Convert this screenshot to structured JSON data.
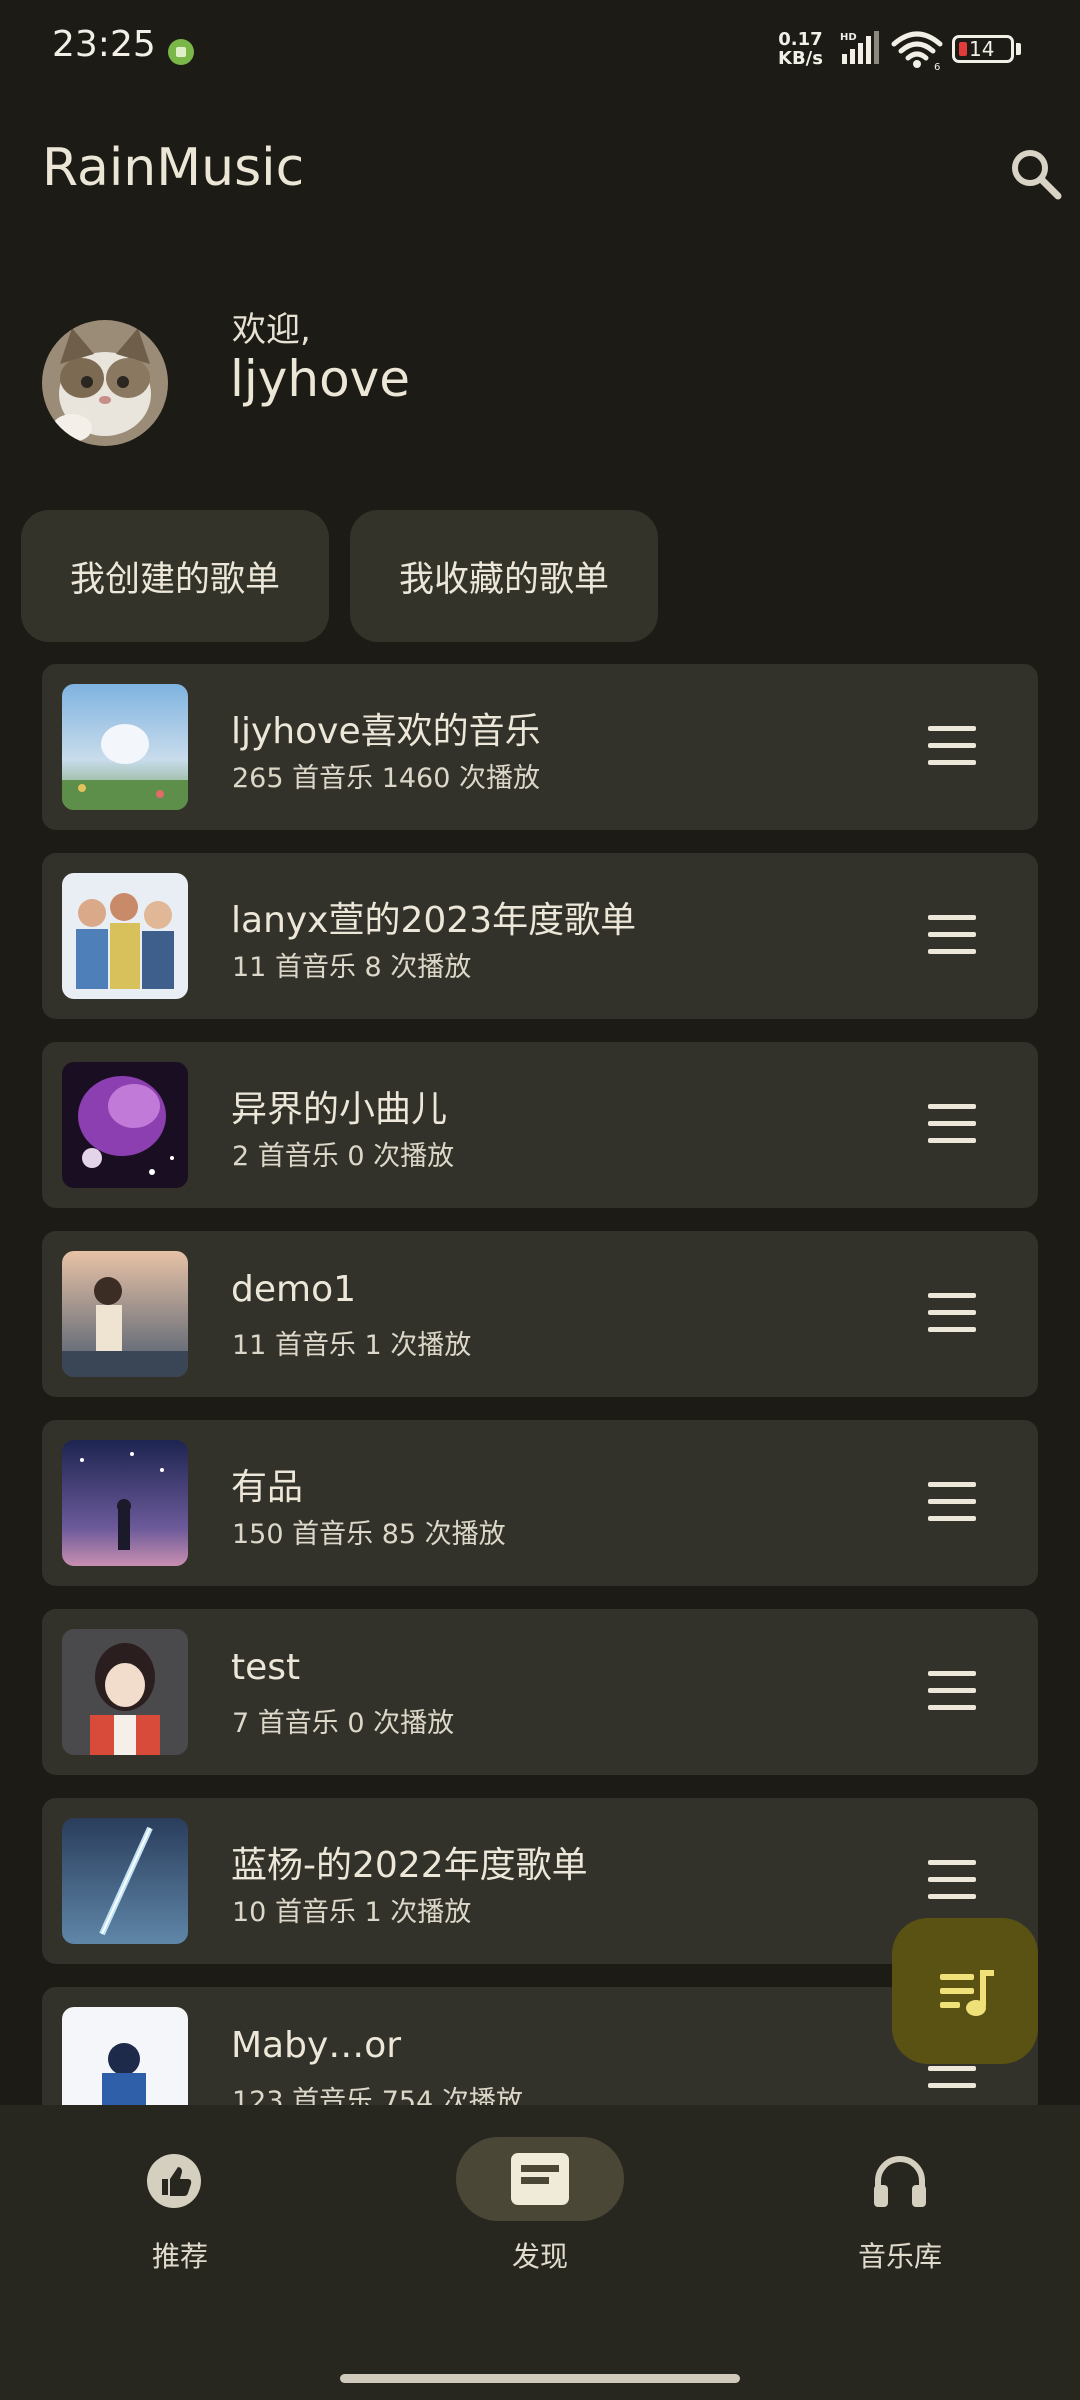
{
  "status_bar": {
    "time": "23:25",
    "net_speed_value": "0.17",
    "net_speed_unit": "KB/s",
    "network_label": "HD",
    "battery": "14",
    "wifi_label": "6"
  },
  "header": {
    "title": "RainMusic",
    "search_icon": "search-icon"
  },
  "welcome": {
    "greeting": "欢迎,",
    "username": "ljyhove"
  },
  "chips": {
    "created": "我创建的歌单",
    "collected": "我收藏的歌单"
  },
  "playlists": [
    {
      "title": "ljyhove喜欢的音乐",
      "subtitle": "265 首音乐 1460 次播放"
    },
    {
      "title": "lanyx萱的2023年度歌单",
      "subtitle": "11 首音乐 8 次播放"
    },
    {
      "title": "异界的小曲儿",
      "subtitle": "2 首音乐 0 次播放"
    },
    {
      "title": "demo1",
      "subtitle": "11 首音乐 1 次播放"
    },
    {
      "title": "有品",
      "subtitle": "150 首音乐 85 次播放"
    },
    {
      "title": "test",
      "subtitle": "7 首音乐 0 次播放"
    },
    {
      "title": "蓝杨-的2022年度歌单",
      "subtitle": "10 首音乐 1 次播放"
    },
    {
      "title": "Maby…or",
      "subtitle": "123 首音乐 754 次播放"
    }
  ],
  "nav": {
    "recommend": "推荐",
    "discover": "发现",
    "library": "音乐库",
    "selected": "discover"
  },
  "colors": {
    "background": "#1c1b16",
    "card": "#33322a",
    "fab": "#5a5213",
    "fab_icon": "#f0e07a"
  }
}
